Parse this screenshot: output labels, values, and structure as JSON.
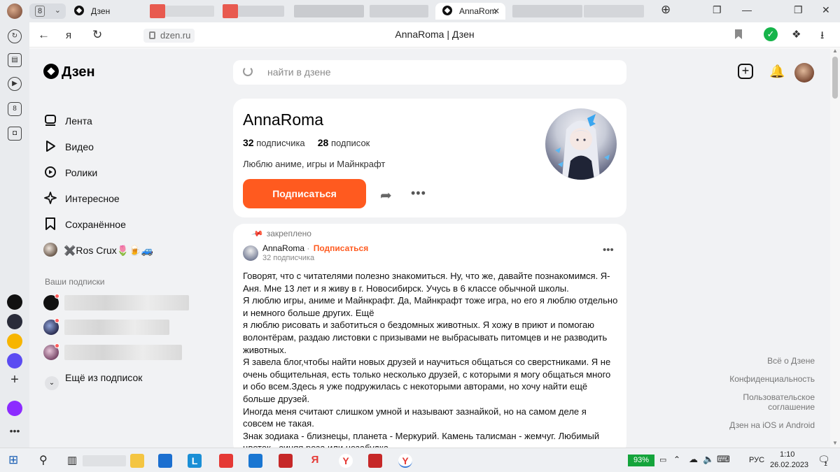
{
  "browser": {
    "tab_counter": "8",
    "tabs": [
      {
        "label": "Дзен"
      },
      {
        "label": "AnnaRoma | Дзен",
        "short": "AnnaRom"
      }
    ],
    "url": "dzen.ru",
    "page_title": "AnnaRoma | Дзен"
  },
  "app": {
    "logo": "Дзен",
    "search_placeholder": "найти в дзене",
    "nav": [
      {
        "label": "Лента",
        "icon": "feed-icon"
      },
      {
        "label": "Видео",
        "icon": "play-icon"
      },
      {
        "label": "Ролики",
        "icon": "shorts-icon"
      },
      {
        "label": "Интересное",
        "icon": "sparkle-icon"
      },
      {
        "label": "Сохранённое",
        "icon": "bookmark-icon"
      },
      {
        "label": "✖️Ros Crux🌷🍺🚙",
        "icon": "avatar"
      }
    ],
    "subscriptions_heading": "Ваши подписки",
    "more_subscriptions": "Ещё из подписок",
    "footer": {
      "about": "Всё о Дзене",
      "privacy": "Конфиденциальность",
      "terms": "Пользовательское соглашение",
      "apps": "Дзен на iOS и Android"
    }
  },
  "channel": {
    "name": "AnnaRoma",
    "subscribers_count": "32",
    "subscribers_label": "подписчика",
    "subscriptions_count": "28",
    "subscriptions_label": "подписок",
    "description": "Люблю аниме, игры и Майнкрафт",
    "subscribe_label": "Подписаться"
  },
  "post": {
    "pinned_label": "закреплено",
    "author": "AnnaRoma",
    "separator": "·",
    "subscribe_label": "Подписаться",
    "subscribers": "32 подписчика",
    "paragraphs": [
      "Говорят, что с читателями полезно знакомиться. Ну, что же, давайте познакомимся. Я-Аня. Мне 13 лет и я живу в г. Новосибирск. Учусь в 6 классе обычной школы.",
      "Я люблю игры, аниме и Майнкрафт. Да, Майнкрафт тоже игра, но его я люблю отдельно и немного больше других. Ещё",
      "я люблю рисовать и заботиться о бездомных животных. Я хожу в приют и помогаю волонтёрам, раздаю листовки с призывами не выбрасывать питомцев и не разводить животных.",
      "Я завела блог,чтобы найти новых друзей и научиться общаться со сверстниками. Я не очень общительная, есть только несколько друзей, с которыми я могу общаться много и обо всем.Здесь я уже подружилась с некоторыми авторами, но хочу найти ещё больше друзей.",
      "Иногда меня считают слишком умной и называют зазнайкой, но на самом деле я совсем не такая.",
      "Знак зодиака - близнецы, планета - Меркурий. Камень талисман - жемчуг. Любимый цветок - синяя роза или незабудка."
    ]
  },
  "taskbar": {
    "battery": "93%",
    "language": "РУС",
    "time": "1:10",
    "date": "26.02.2023",
    "notification_count": "1"
  },
  "colors": {
    "accent": "#ff5a1f",
    "app_background": "#f1f2f4",
    "battery": "#14a43b"
  }
}
